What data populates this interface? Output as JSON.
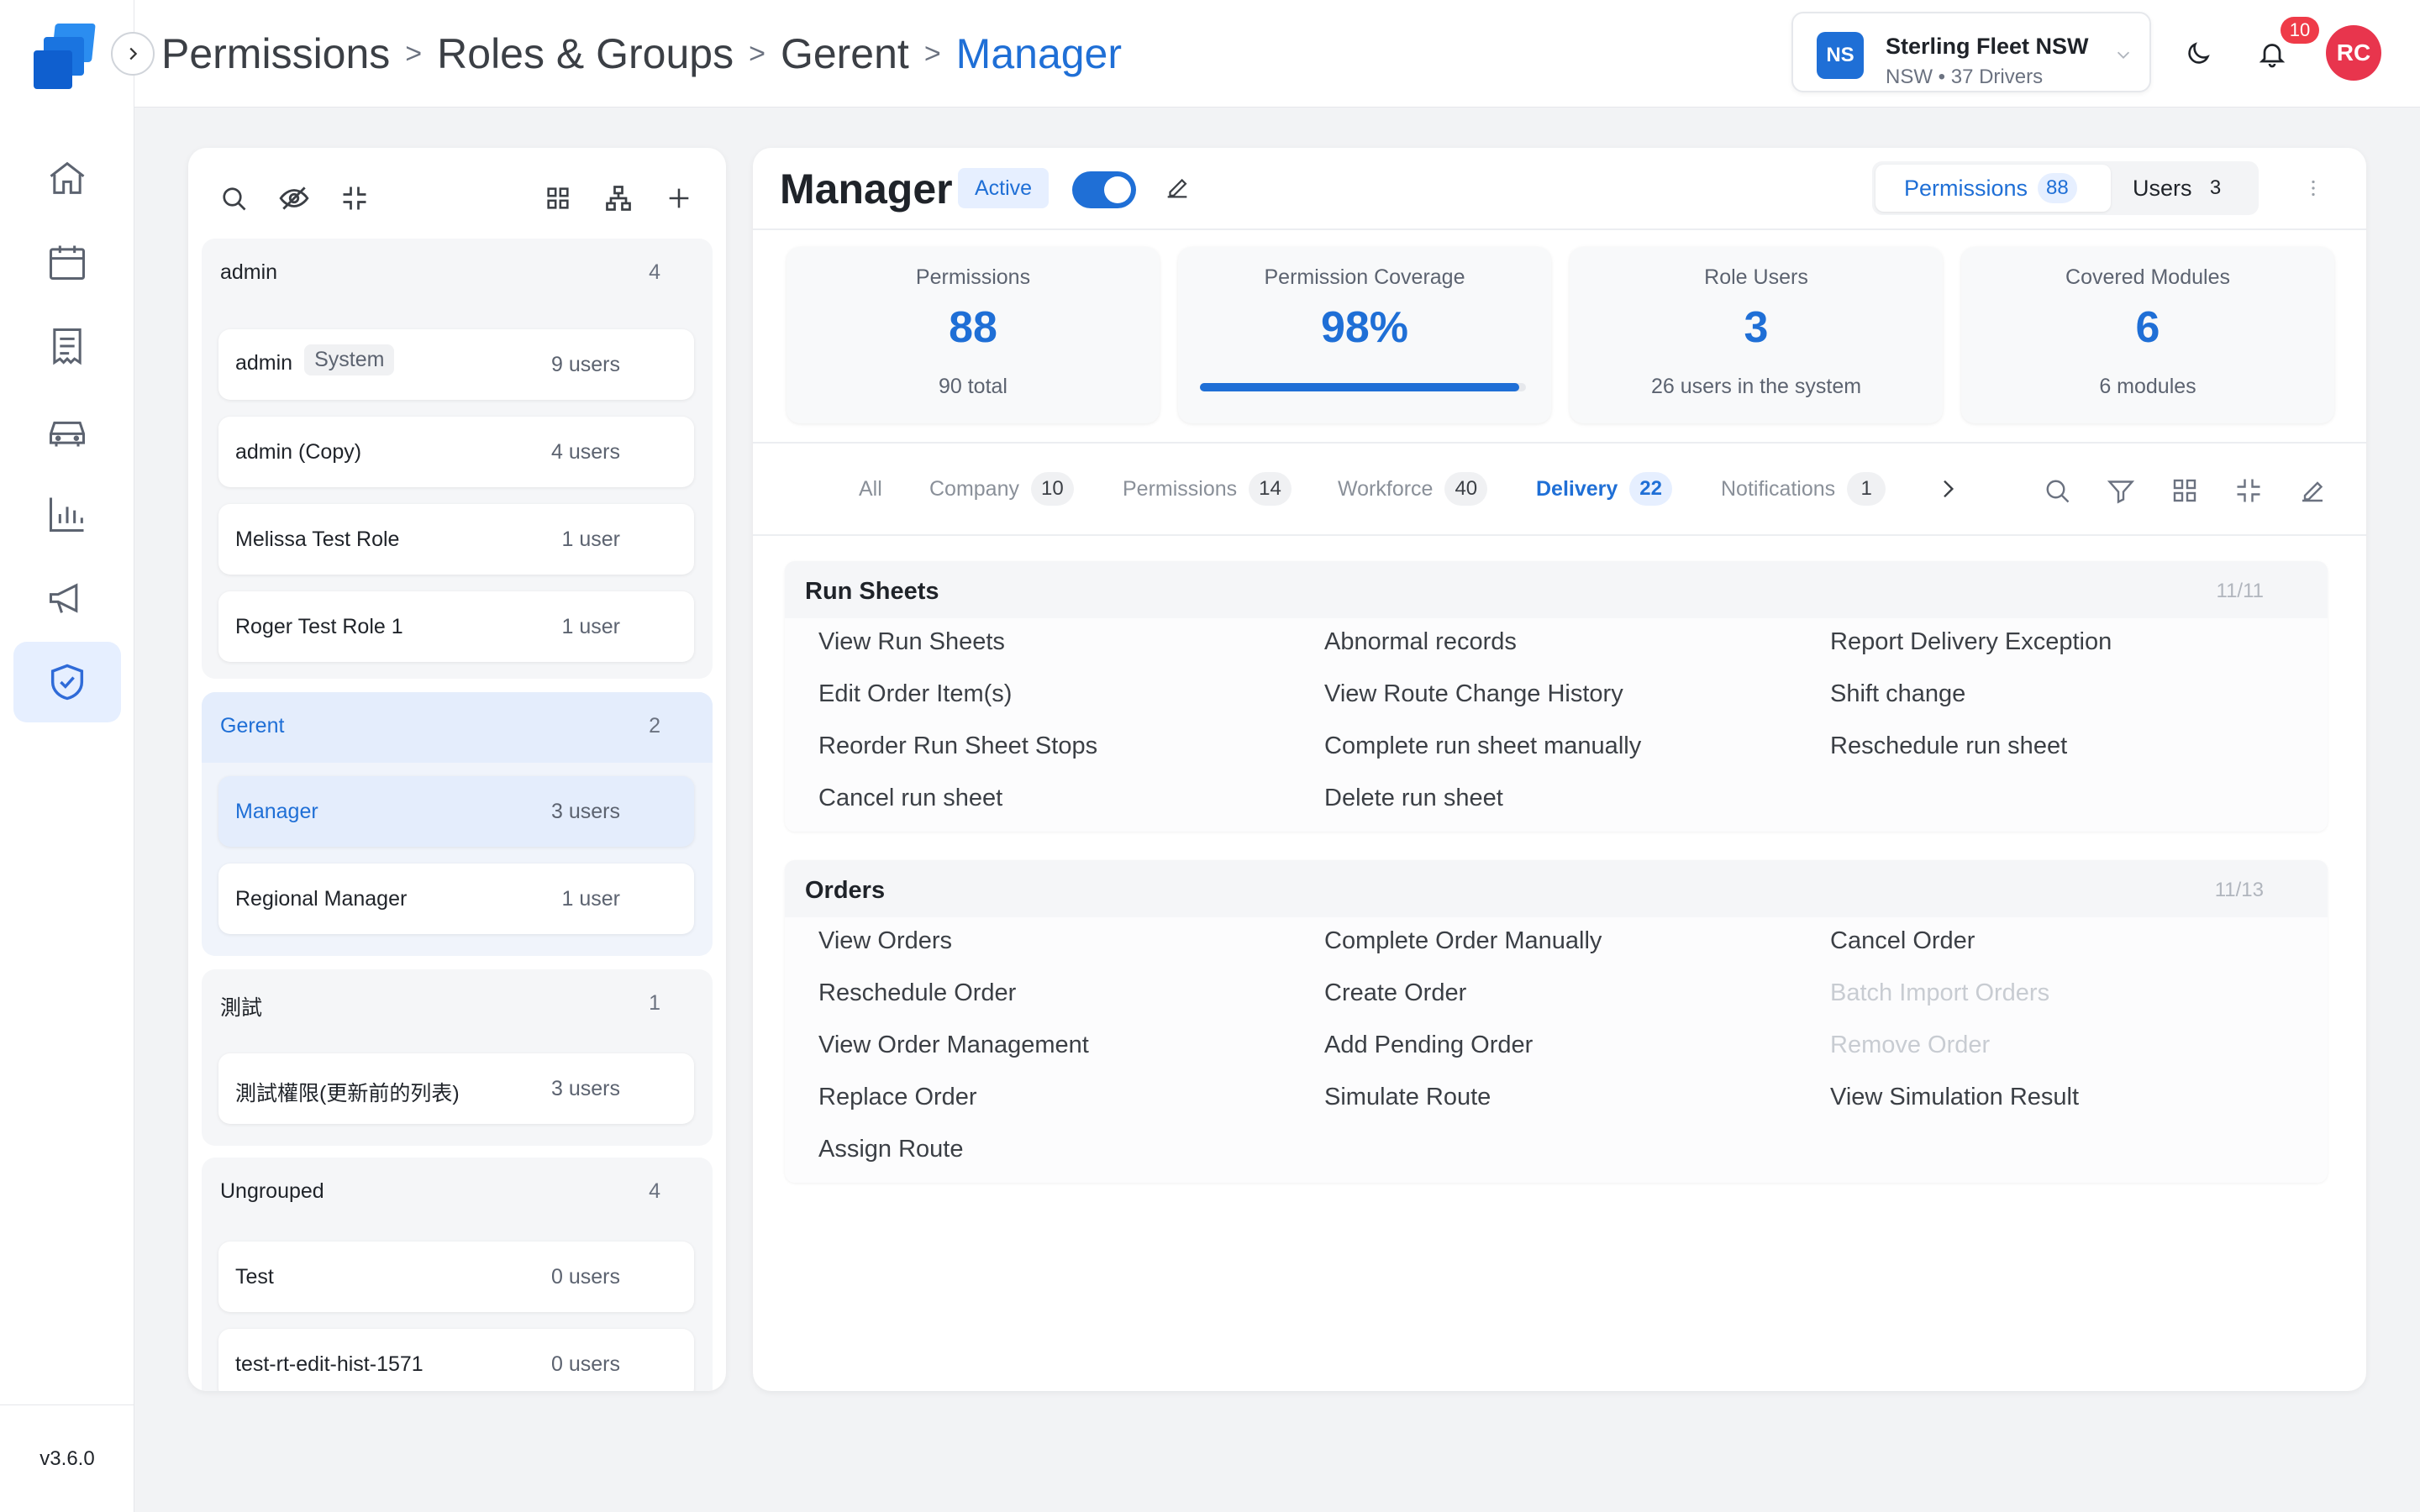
{
  "app": {
    "version": "v3.6.0",
    "nav": [
      {
        "name": "home-icon",
        "active": false
      },
      {
        "name": "calendar-icon",
        "active": false
      },
      {
        "name": "document-icon",
        "active": false
      },
      {
        "name": "vehicle-icon",
        "active": false
      },
      {
        "name": "chart-icon",
        "active": false
      },
      {
        "name": "megaphone-icon",
        "active": false
      },
      {
        "name": "shield-check-icon",
        "active": true
      }
    ]
  },
  "header": {
    "breadcrumb": [
      "Permissions",
      "Roles & Groups",
      "Gerent",
      "Manager"
    ],
    "separator": ">",
    "org": {
      "initials": "NS",
      "name": "Sterling Fleet NSW",
      "sub": "NSW • 37 Drivers"
    },
    "notifications": "10",
    "user_initials": "RC"
  },
  "groups": [
    {
      "name": "admin",
      "count": "4",
      "roles": [
        {
          "name": "admin",
          "tag": "System",
          "users": "9 users"
        },
        {
          "name": "admin (Copy)",
          "users": "4 users"
        },
        {
          "name": "Melissa Test Role",
          "users": "1 user"
        },
        {
          "name": "Roger Test Role 1",
          "users": "1 user"
        }
      ]
    },
    {
      "name": "Gerent",
      "count": "2",
      "roles": [
        {
          "name": "Manager",
          "users": "3 users"
        },
        {
          "name": "Regional Manager",
          "users": "1 user"
        }
      ]
    },
    {
      "name": "測試",
      "count": "1",
      "roles": [
        {
          "name": "測試權限(更新前的列表)",
          "users": "3 users"
        }
      ]
    },
    {
      "name": "Ungrouped",
      "count": "4",
      "roles": [
        {
          "name": "Test",
          "users": "0 users"
        },
        {
          "name": "test-rt-edit-hist-1571",
          "users": "0 users"
        }
      ]
    }
  ],
  "role": {
    "title": "Manager",
    "status": "Active",
    "enabled": true,
    "segments": [
      {
        "label": "Permissions",
        "count": "88",
        "active": true
      },
      {
        "label": "Users",
        "count": "3",
        "active": false
      }
    ]
  },
  "stats": [
    {
      "label": "Permissions",
      "value": "88",
      "sub": "90 total"
    },
    {
      "label": "Permission Coverage",
      "value": "98%",
      "progress": 0.98
    },
    {
      "label": "Role Users",
      "value": "3",
      "sub": "26 users in the system"
    },
    {
      "label": "Covered Modules",
      "value": "6",
      "sub": "6 modules"
    }
  ],
  "tabs": [
    {
      "label": "All"
    },
    {
      "label": "Company",
      "count": "10"
    },
    {
      "label": "Permissions",
      "count": "14"
    },
    {
      "label": "Workforce",
      "count": "40"
    },
    {
      "label": "Delivery",
      "count": "22",
      "active": true
    },
    {
      "label": "Notifications",
      "count": "1"
    }
  ],
  "sections": [
    {
      "title": "Run Sheets",
      "count": "11/11",
      "items": [
        {
          "label": "View Run Sheets"
        },
        {
          "label": "Abnormal records"
        },
        {
          "label": "Report Delivery Exception"
        },
        {
          "label": "Edit Order Item(s)"
        },
        {
          "label": "View Route Change History"
        },
        {
          "label": "Shift change"
        },
        {
          "label": "Reorder Run Sheet Stops"
        },
        {
          "label": "Complete run sheet manually"
        },
        {
          "label": "Reschedule run sheet"
        },
        {
          "label": "Cancel run sheet"
        },
        {
          "label": "Delete run sheet"
        }
      ]
    },
    {
      "title": "Orders",
      "count": "11/13",
      "items": [
        {
          "label": "View Orders"
        },
        {
          "label": "Complete Order Manually"
        },
        {
          "label": "Cancel Order"
        },
        {
          "label": "Reschedule Order"
        },
        {
          "label": "Create Order"
        },
        {
          "label": "Batch Import Orders",
          "disabled": true
        },
        {
          "label": "View Order Management"
        },
        {
          "label": "Add Pending Order"
        },
        {
          "label": "Remove Order",
          "disabled": true
        },
        {
          "label": "Replace Order"
        },
        {
          "label": "Simulate Route"
        },
        {
          "label": "View Simulation Result"
        },
        {
          "label": "Assign Route"
        }
      ]
    }
  ]
}
